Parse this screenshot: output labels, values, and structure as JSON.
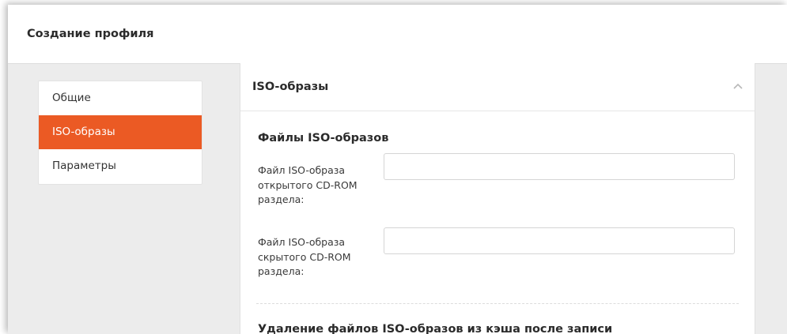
{
  "header": {
    "title": "Создание профиля"
  },
  "sidebar": {
    "items": [
      {
        "label": "Общие"
      },
      {
        "label": "ISO-образы"
      },
      {
        "label": "Параметры"
      }
    ]
  },
  "panel": {
    "title": "ISO-образы",
    "collapse_icon": "chevron-up-icon",
    "section1_title": "Файлы ISO-образов",
    "fields": [
      {
        "label": "Файл ISO-образа открытого CD-ROM раздела:",
        "value": ""
      },
      {
        "label": "Файл ISO-образа скрытого CD-ROM раздела:",
        "value": ""
      }
    ],
    "section2_title": "Удаление файлов ISO-образов из кэша после записи"
  },
  "colors": {
    "accent": "#eb5a24",
    "background": "#ececec"
  }
}
